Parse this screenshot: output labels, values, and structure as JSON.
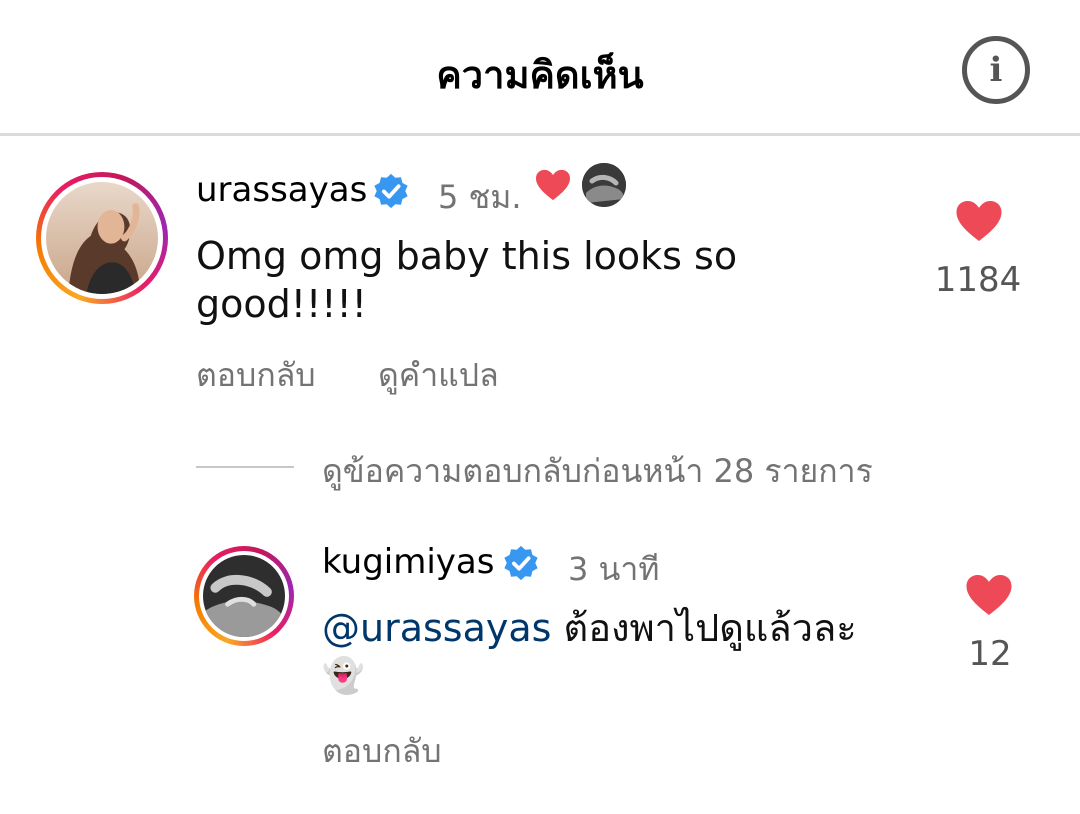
{
  "header": {
    "title": "ความคิดเห็น",
    "info_icon": "info-icon"
  },
  "colors": {
    "verified": "#3897f0",
    "heart": "#ed4956",
    "mention": "#00376b",
    "secondary_text": "#737373"
  },
  "comment": {
    "username": "urassayas",
    "time": "5 ชม.",
    "text_line1": "Omg omg baby this looks so",
    "text_line2": "good!!!!!",
    "reply_label": "ตอบกลับ",
    "translate_label": "ดูคำแปล",
    "like_count": "1184"
  },
  "replies": {
    "view_previous_label": "ดูข้อความตอบกลับก่อนหน้า 28 รายการ"
  },
  "reply": {
    "username": "kugimiyas",
    "time": "3 นาที",
    "mention": "@urassayas",
    "text": " ต้องพาไปดูแล้วละ",
    "emoji": "👻",
    "reply_label": "ตอบกลับ",
    "like_count": "12"
  }
}
